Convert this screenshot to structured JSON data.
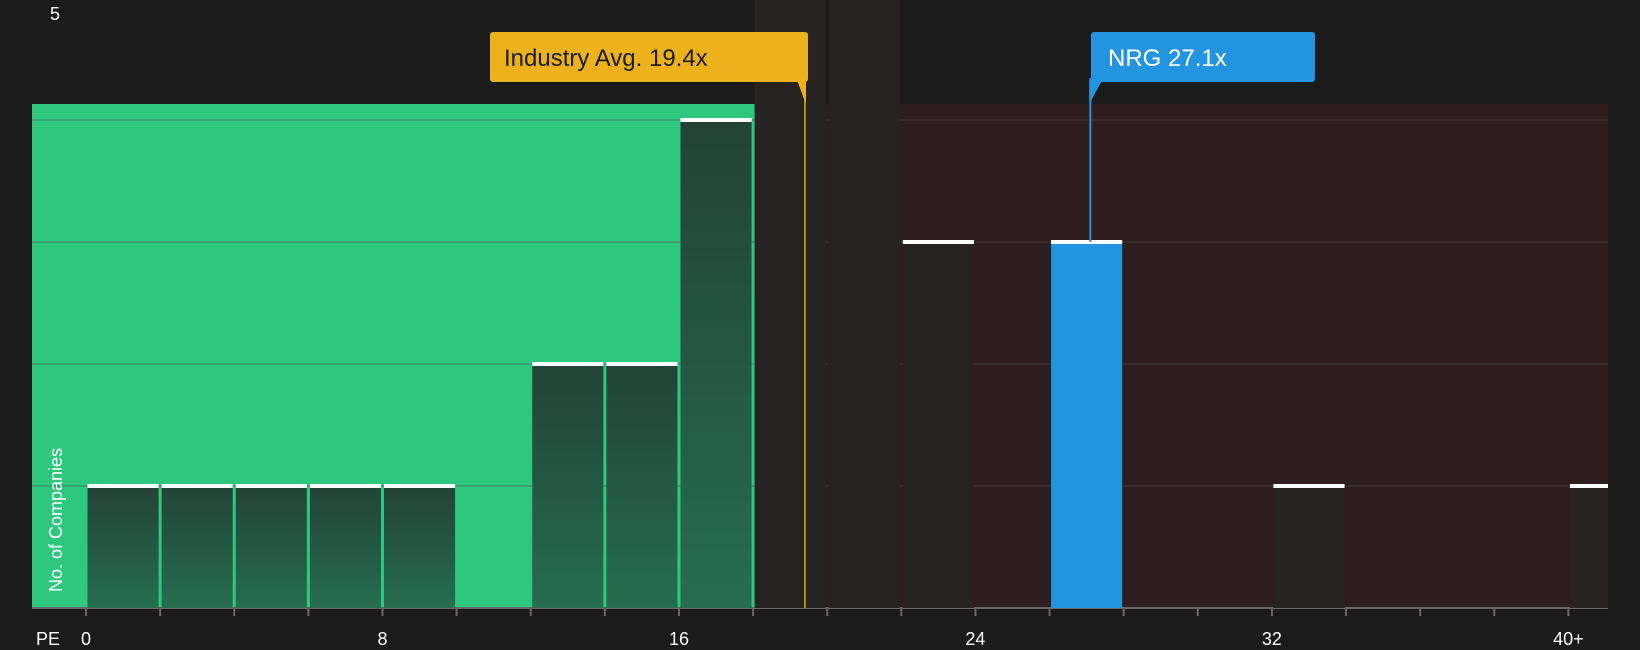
{
  "chart_data": {
    "type": "bar",
    "title": "",
    "xlabel": "PE",
    "ylabel": "No. of Companies",
    "xlim": [
      0,
      40
    ],
    "ylim": [
      0,
      5
    ],
    "bin_width": 2,
    "x_ticks": [
      {
        "value": 0,
        "label": "0"
      },
      {
        "value": 8,
        "label": "8"
      },
      {
        "value": 16,
        "label": "16"
      },
      {
        "value": 24,
        "label": "24"
      },
      {
        "value": 32,
        "label": "32"
      },
      {
        "value": 40,
        "label": "40+"
      }
    ],
    "y_ticks": [
      {
        "value": 5,
        "label": "5"
      }
    ],
    "bins": [
      {
        "x_start": 0,
        "count": 1
      },
      {
        "x_start": 2,
        "count": 1
      },
      {
        "x_start": 4,
        "count": 1
      },
      {
        "x_start": 6,
        "count": 1
      },
      {
        "x_start": 8,
        "count": 1
      },
      {
        "x_start": 12,
        "count": 2
      },
      {
        "x_start": 14,
        "count": 2
      },
      {
        "x_start": 16,
        "count": 4
      },
      {
        "x_start": 18,
        "count": 5
      },
      {
        "x_start": 20,
        "count": 5
      },
      {
        "x_start": 22,
        "count": 3
      },
      {
        "x_start": 26,
        "count": 3,
        "highlight": true
      },
      {
        "x_start": 32,
        "count": 1
      },
      {
        "x_start": 40,
        "count": 1
      }
    ],
    "industry_average": {
      "value": 19.4,
      "label": "Industry Avg. 19.4x"
    },
    "company": {
      "value": 27.1,
      "label": "NRG 27.1x"
    },
    "undervalued_zone_end": 18.5
  },
  "colors": {
    "background": "#1b1b1b",
    "undervalued_zone": "#2ec780",
    "overvalued_zone": "#2e1e1f",
    "bar_dark": "#244b3b",
    "bar_neutral": "#272323",
    "bar_highlight": "#2394df",
    "bar_cap": "#ffffff",
    "industry_callout": "#edb11c",
    "company_callout": "#2394df",
    "gridline": "#4e4848",
    "axis_text": "#ffffff"
  }
}
